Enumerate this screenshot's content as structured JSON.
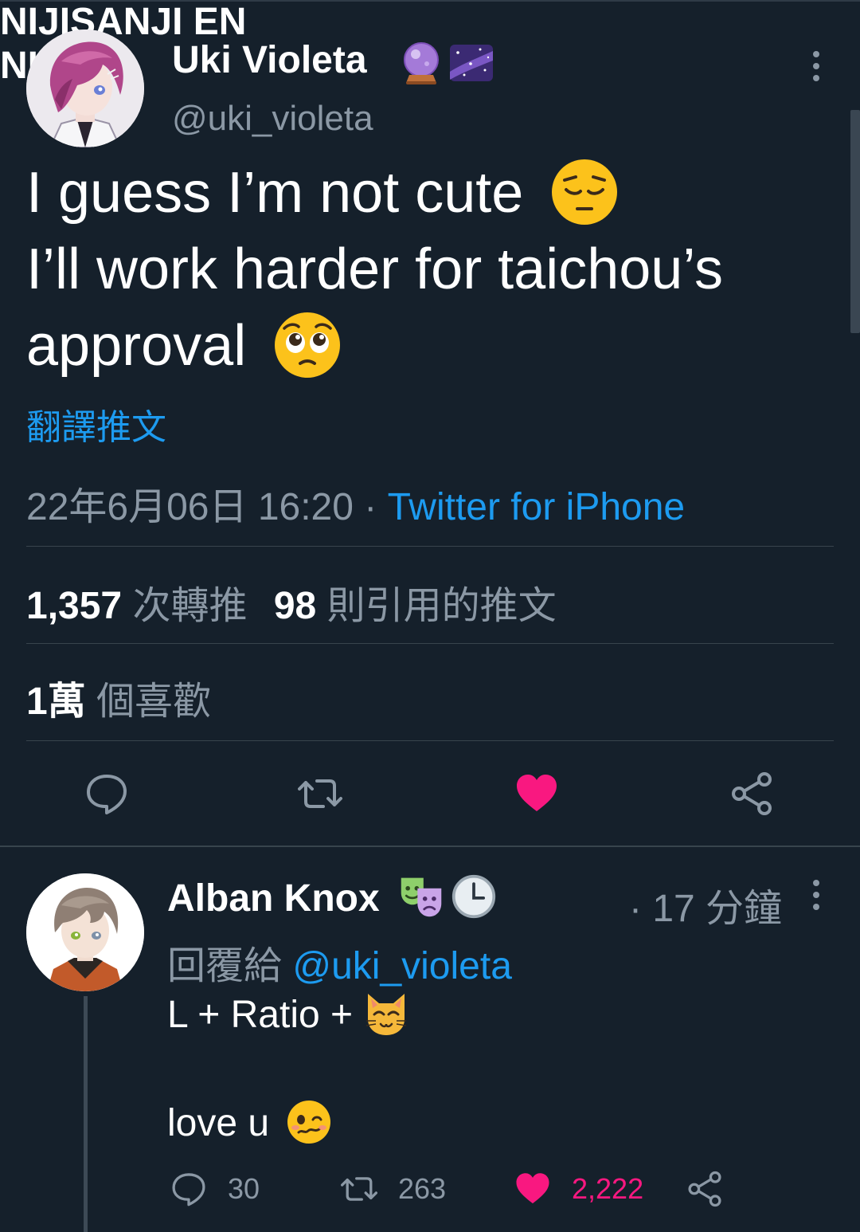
{
  "main_tweet": {
    "author_name": "Uki Violeta",
    "badges": [
      "crystal-ball-icon",
      "milky-way-icon"
    ],
    "org": "NIJISANJI EN",
    "handle": "@uki_violeta",
    "lines": [
      "I guess I’m not cute",
      "I’ll work harder for taichou’s",
      "approval"
    ],
    "line_emojis": [
      "pensive-face-icon",
      "",
      "pleading-face-icon"
    ],
    "translate_label": "翻譯推文",
    "timestamp": "22年6月06日 16:20",
    "separator": "·",
    "source": "Twitter for iPhone",
    "retweets_count": "1,357",
    "retweets_label": "次轉推",
    "quotes_count": "98",
    "quotes_label": "則引用的推文",
    "likes_count": "1萬",
    "likes_label": "個喜歡",
    "liked": true
  },
  "reply": {
    "author_name": "Alban Knox",
    "badges": [
      "performing-arts-icon",
      "clock-icon"
    ],
    "org": "NIJI...",
    "separator": "·",
    "time": "17 分鐘",
    "reply_prefix": "回覆給",
    "reply_mention": "@uki_violeta",
    "line1": "L + Ratio +",
    "line2": "love u",
    "replies_count": "30",
    "retweets_count": "263",
    "likes_count": "2,222",
    "liked": true
  },
  "colors": {
    "background": "#15202b",
    "link": "#1d9bf0",
    "muted": "#8b98a5",
    "like": "#f91880",
    "divider": "#38444d"
  }
}
